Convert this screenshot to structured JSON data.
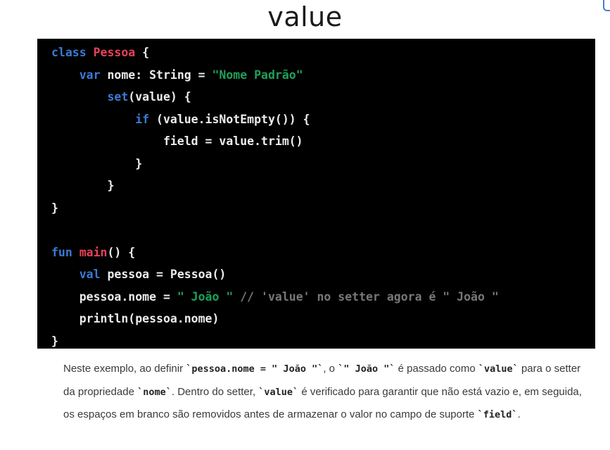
{
  "slide": {
    "title": "value"
  },
  "code": {
    "lines": [
      [
        {
          "t": "class ",
          "c": "kw"
        },
        {
          "t": "Pessoa",
          "c": "cls"
        },
        {
          "t": " {",
          "c": "plain"
        }
      ],
      [
        {
          "t": "    var ",
          "c": "kw"
        },
        {
          "t": "nome: String = ",
          "c": "plain"
        },
        {
          "t": "\"Nome Padrão\"",
          "c": "str"
        }
      ],
      [
        {
          "t": "        set",
          "c": "kw"
        },
        {
          "t": "(value) {",
          "c": "plain"
        }
      ],
      [
        {
          "t": "            if",
          "c": "kw"
        },
        {
          "t": " (value.isNotEmpty()) {",
          "c": "plain"
        }
      ],
      [
        {
          "t": "                field = value.trim()",
          "c": "plain"
        }
      ],
      [
        {
          "t": "            }",
          "c": "plain"
        }
      ],
      [
        {
          "t": "        }",
          "c": "plain"
        }
      ],
      [
        {
          "t": "}",
          "c": "plain"
        }
      ],
      [],
      [
        {
          "t": "fun ",
          "c": "kw"
        },
        {
          "t": "main",
          "c": "cls"
        },
        {
          "t": "() {",
          "c": "plain"
        }
      ],
      [
        {
          "t": "    val ",
          "c": "kw"
        },
        {
          "t": "pessoa = Pessoa()",
          "c": "plain"
        }
      ],
      [
        {
          "t": "    pessoa.nome = ",
          "c": "plain"
        },
        {
          "t": "\" João \"",
          "c": "str"
        },
        {
          "t": " // 'value' no setter agora é \" João \"",
          "c": "cmt"
        }
      ],
      [
        {
          "t": "    println(pessoa.nome)",
          "c": "plain"
        }
      ],
      [
        {
          "t": "}",
          "c": "plain"
        }
      ]
    ]
  },
  "explanation": {
    "segments": [
      {
        "t": "Neste exemplo, ao definir ",
        "code": false
      },
      {
        "t": "`pessoa.nome = \" João \"`",
        "code": true
      },
      {
        "t": ", o ",
        "code": false
      },
      {
        "t": "`\" João \"`",
        "code": true
      },
      {
        "t": " é passado como ",
        "code": false
      },
      {
        "t": "`value`",
        "code": true
      },
      {
        "t": " para o setter da propriedade ",
        "code": false
      },
      {
        "t": "`nome`",
        "code": true
      },
      {
        "t": ". Dentro do setter, ",
        "code": false
      },
      {
        "t": "`value`",
        "code": true
      },
      {
        "t": " é verificado para garantir que não está vazio e, em seguida, os espaços em branco são removidos antes de armazenar o valor no campo de suporte ",
        "code": false
      },
      {
        "t": "`field`",
        "code": true
      },
      {
        "t": ".",
        "code": false
      }
    ]
  },
  "colors": {
    "keyword": "#3a7bd5",
    "class_name": "#e8415a",
    "string": "#1fa05a",
    "comment": "#777777",
    "code_background": "#000000"
  }
}
